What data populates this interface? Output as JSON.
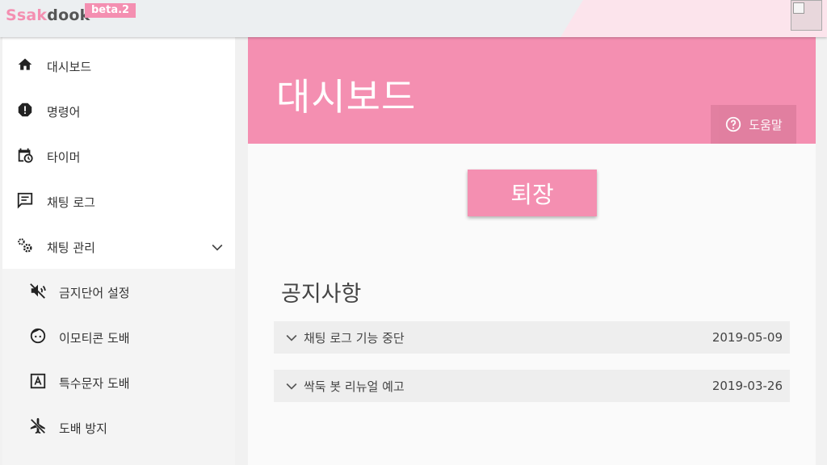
{
  "topbar": {
    "brand_s": "Ssak",
    "brand_d": "dook",
    "beta": "beta.2"
  },
  "sidebar": {
    "items": [
      {
        "label": "대시보드",
        "icon": "home-icon"
      },
      {
        "label": "명령어",
        "icon": "alert-octagon-icon"
      },
      {
        "label": "타이머",
        "icon": "calendar-clock-icon"
      },
      {
        "label": "채팅 로그",
        "icon": "message-text-icon"
      },
      {
        "label": "채팅 관리",
        "icon": "cogs-icon",
        "expanded": true
      }
    ],
    "children": [
      {
        "label": "금지단어 설정",
        "icon": "volume-off-icon"
      },
      {
        "label": "이모티콘 도배",
        "icon": "emoticon-icon"
      },
      {
        "label": "특수문자 도배",
        "icon": "alpha-a-box-icon"
      },
      {
        "label": "도배 방지",
        "icon": "airplane-off-icon"
      }
    ]
  },
  "main": {
    "title": "대시보드",
    "help_label": "도움말",
    "leave_label": "퇴장",
    "notice_title": "공지사항",
    "notices": [
      {
        "title": "채팅 로그 기능 중단",
        "date": "2019-05-09"
      },
      {
        "title": "싹둑 봇 리뉴얼 예고",
        "date": "2019-03-26"
      }
    ]
  },
  "colors": {
    "accent": "#f48fb1",
    "topbar": "#eceff1"
  }
}
